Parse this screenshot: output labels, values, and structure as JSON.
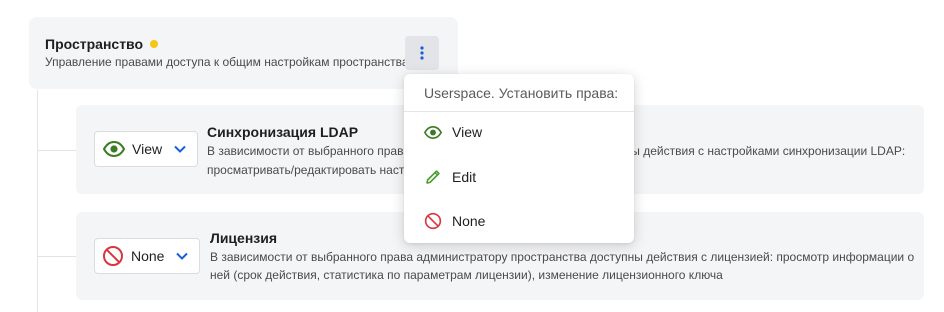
{
  "space": {
    "title": "Пространство",
    "description": "Управление правами доступа к общим настройкам пространства"
  },
  "rows": [
    {
      "title": "Синхронизация LDAP",
      "permission": "View",
      "permission_icon": "eye-icon",
      "description_line1": "В зависимости от выбранного права администратору пространства доступны действия с настройками синхронизации LDAP:",
      "description_line2": "просматривать/редактировать настройки синхронизации LDAP"
    },
    {
      "title": "Лицензия",
      "permission": "None",
      "permission_icon": "forbidden-icon",
      "description_line1": "В зависимости от выбранного права администратору пространства доступны действия с лицензией: просмотр информации о",
      "description_line2": "ней (срок действия, статистика по параметрам лицензии), изменение лицензионного ключа"
    }
  ],
  "dropdown": {
    "header": "Userspace. Установить права:",
    "items": [
      {
        "label": "View",
        "icon": "eye-icon"
      },
      {
        "label": "Edit",
        "icon": "pencil-icon"
      },
      {
        "label": "None",
        "icon": "forbidden-icon"
      }
    ]
  },
  "colors": {
    "status_dot": "#f5c518",
    "view_green": "#3b7d23",
    "edit_green": "#4c9a2a",
    "none_red": "#d9363e",
    "chevron_blue": "#1a5fd6",
    "more_blue": "#1a5fd6"
  }
}
